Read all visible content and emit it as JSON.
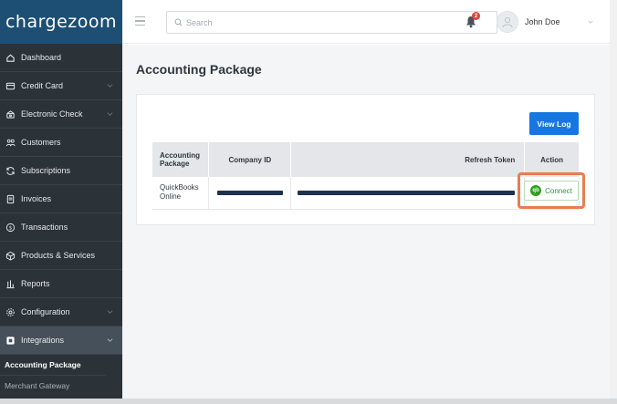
{
  "app": {
    "logo": "chargezoom"
  },
  "sidebar": {
    "items": [
      {
        "label": "Dashboard",
        "icon": "home-icon"
      },
      {
        "label": "Credit Card",
        "icon": "credit-card-icon",
        "has_chevron": true
      },
      {
        "label": "Electronic Check",
        "icon": "bank-icon",
        "has_chevron": true
      },
      {
        "label": "Customers",
        "icon": "users-icon"
      },
      {
        "label": "Subscriptions",
        "icon": "refresh-icon"
      },
      {
        "label": "Invoices",
        "icon": "invoice-icon"
      },
      {
        "label": "Transactions",
        "icon": "dollar-icon"
      },
      {
        "label": "Products & Services",
        "icon": "box-icon"
      },
      {
        "label": "Reports",
        "icon": "chart-icon"
      },
      {
        "label": "Configuration",
        "icon": "gear-icon",
        "has_chevron": true
      },
      {
        "label": "Integrations",
        "icon": "integration-icon",
        "has_chevron": true,
        "active": true
      }
    ],
    "subitems": [
      {
        "label": "Accounting Package",
        "active": true
      },
      {
        "label": "Merchant Gateway"
      }
    ]
  },
  "header": {
    "search_placeholder": "Search",
    "notification_count": "2",
    "user_name": "John Doe"
  },
  "main": {
    "title": "Accounting Package",
    "view_log_label": "View Log",
    "table": {
      "headers": [
        "Accounting Package",
        "Company ID",
        "Refresh Token",
        "Action"
      ],
      "rows": [
        {
          "package": "QuickBooks Online",
          "company_id_redacted": true,
          "refresh_token_redacted": true,
          "action": "Connect"
        }
      ]
    }
  },
  "colors": {
    "sidebar_bg": "#2b3238",
    "logo_bg": "#1d4e74",
    "primary": "#1677e0",
    "highlight": "#e97d4f",
    "quickbooks_green": "#2ca01c"
  }
}
